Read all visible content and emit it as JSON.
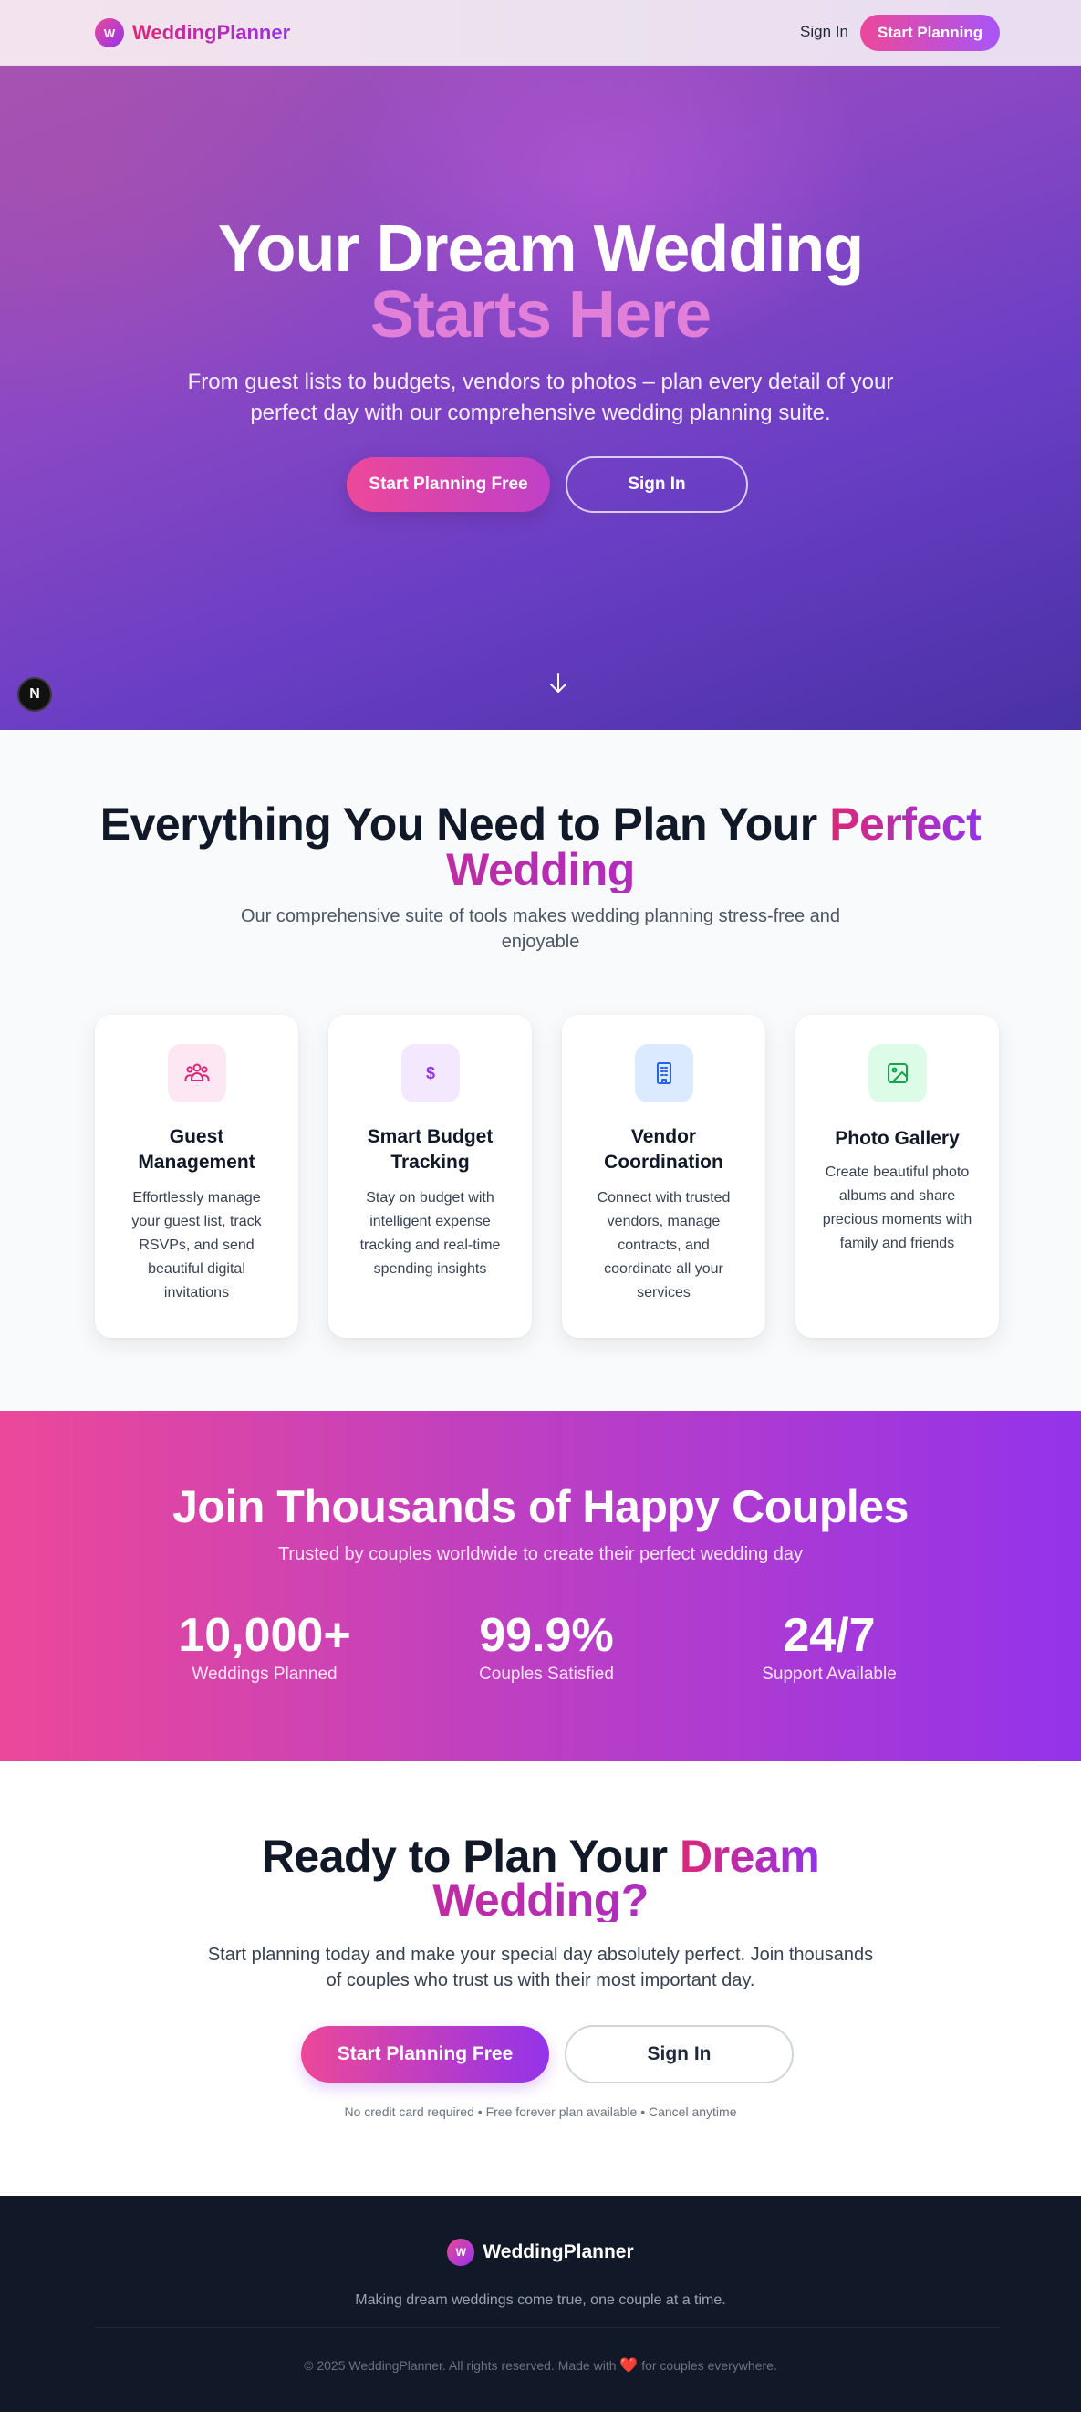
{
  "nav": {
    "logo_letter": "W",
    "brand": "WeddingPlanner",
    "signin": "Sign In",
    "cta": "Start Planning"
  },
  "hero": {
    "title_line1": "Your Dream Wedding",
    "title_line2": "Starts Here",
    "subtitle": "From guest lists to budgets, vendors to photos – plan every detail of your perfect day with our comprehensive wedding planning suite.",
    "primary_button": "Start Planning Free",
    "secondary_button": "Sign In",
    "scroll_icon": "arrow-down-icon",
    "badge_letter": "N"
  },
  "features": {
    "title_part1": "Everything You Need to Plan Your",
    "title_highlight_1": "Perfect",
    "title_highlight_2": "Wedding",
    "subtitle": "Our comprehensive suite of tools makes wedding planning stress-free and enjoyable",
    "cards": [
      {
        "title": "Guest Management",
        "description": "Effortlessly manage your guest list, track RSVPs, and send beautiful digital invitations",
        "icon": "users-icon",
        "icon_color": "#db2777",
        "icon_bg": "#fce7f3"
      },
      {
        "title": "Smart Budget Tracking",
        "description": "Stay on budget with intelligent expense tracking and real-time spending insights",
        "icon": "dollar-icon",
        "icon_symbol": "$",
        "icon_color": "#9333ea",
        "icon_bg": "#f3e8ff"
      },
      {
        "title": "Vendor Coordination",
        "description": "Connect with trusted vendors, manage contracts, and coordinate all your services",
        "icon": "building-icon",
        "icon_color": "#2563eb",
        "icon_bg": "#dbeafe"
      },
      {
        "title": "Photo Gallery",
        "description": "Create beautiful photo albums and share precious moments with family and friends",
        "icon": "image-icon",
        "icon_color": "#16a34a",
        "icon_bg": "#dcfce7"
      }
    ]
  },
  "stats": {
    "title": "Join Thousands of Happy Couples",
    "subtitle": "Trusted by couples worldwide to create their perfect wedding day",
    "items": [
      {
        "value": "10,000+",
        "label": "Weddings Planned"
      },
      {
        "value": "99.9%",
        "label": "Couples Satisfied"
      },
      {
        "value": "24/7",
        "label": "Support Available"
      }
    ]
  },
  "cta": {
    "title_part1": "Ready to Plan Your",
    "title_highlight_1": "Dream",
    "title_highlight_2": "Wedding?",
    "subtitle": "Start planning today and make your special day absolutely perfect. Join thousands of couples who trust us with their most important day.",
    "primary_button": "Start Planning Free",
    "secondary_button": "Sign In",
    "note": "No credit card required • Free forever plan available • Cancel anytime"
  },
  "footer": {
    "logo_letter": "W",
    "brand": "WeddingPlanner",
    "tagline": "Making dream weddings come true, one couple at a time.",
    "copyright_before": "© 2025 WeddingPlanner. All rights reserved. Made with",
    "heart": "❤️",
    "copyright_after": "for couples everywhere."
  },
  "colors": {
    "brand_pink": "#ec4899",
    "brand_purple": "#9333ea",
    "dark": "#111827"
  }
}
